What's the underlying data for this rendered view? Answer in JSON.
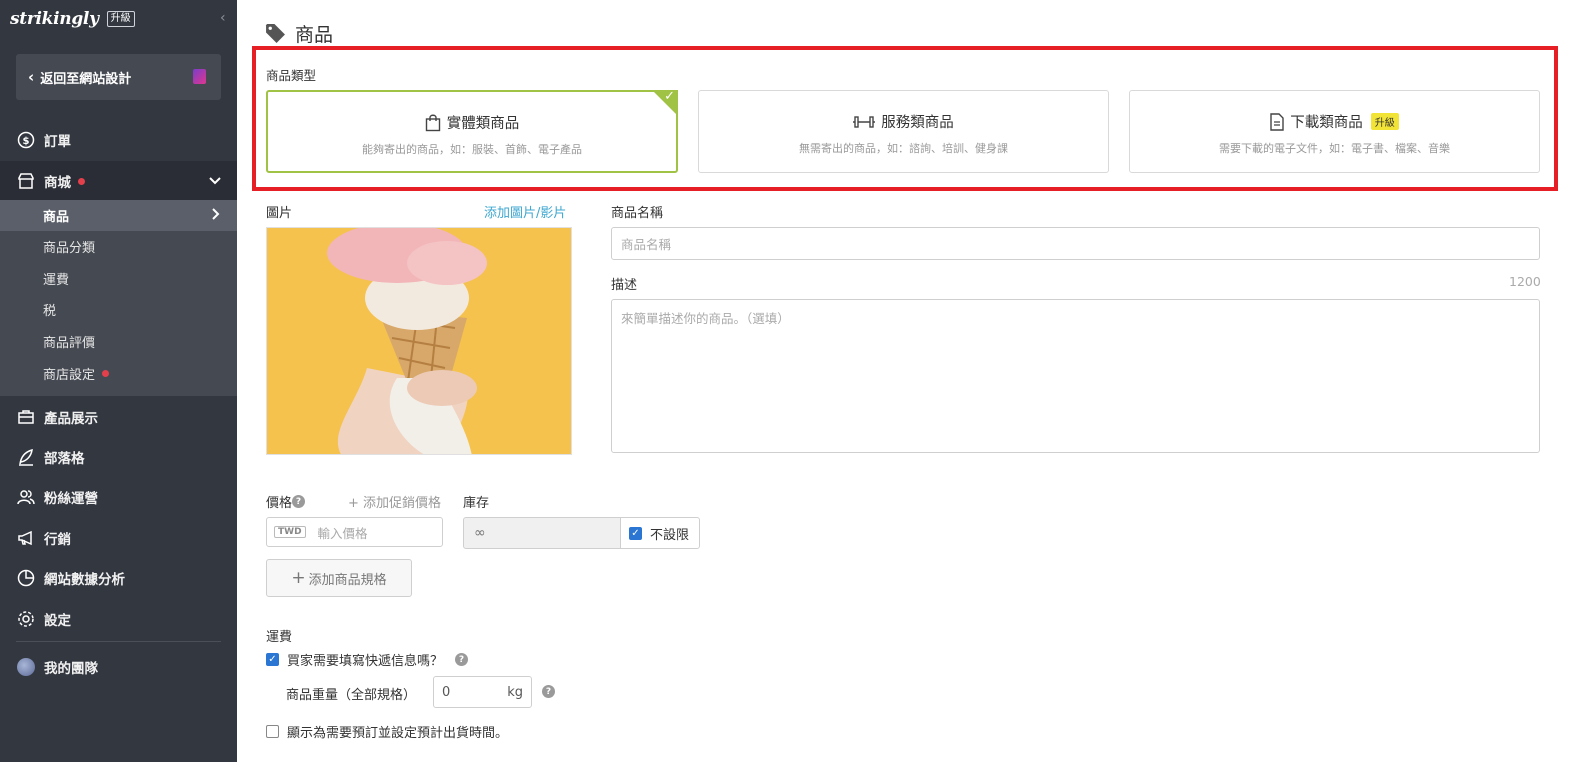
{
  "sidebar": {
    "logo": "strikingly",
    "upgrade": "升級",
    "back": "返回至網站設計",
    "nav": [
      {
        "label": "訂單"
      },
      {
        "label": "商城"
      },
      {
        "label": "產品展示"
      },
      {
        "label": "部落格"
      },
      {
        "label": "粉絲運營"
      },
      {
        "label": "行銷"
      },
      {
        "label": "網站數據分析"
      },
      {
        "label": "設定"
      },
      {
        "label": "我的團隊"
      }
    ],
    "sub": [
      {
        "label": "商品"
      },
      {
        "label": "商品分類"
      },
      {
        "label": "運費"
      },
      {
        "label": "税"
      },
      {
        "label": "商品評價"
      },
      {
        "label": "商店設定"
      }
    ]
  },
  "main": {
    "title": "商品",
    "type_label": "商品類型",
    "types": [
      {
        "title": "實體類商品",
        "desc": "能夠寄出的商品，如：服裝、首飾、電子產品",
        "selected": true
      },
      {
        "title": "服務類商品",
        "desc": "無需寄出的商品，如：諮詢、培訓、健身課",
        "selected": false
      },
      {
        "title": "下載類商品",
        "desc": "需要下載的電子文件，如：電子書、檔案、音樂",
        "badge": "升級",
        "selected": false
      }
    ],
    "image_label": "圖片",
    "add_media": "添加圖片/影片",
    "name_label": "商品名稱",
    "name_placeholder": "商品名稱",
    "desc_label": "描述",
    "desc_counter": "1200",
    "desc_placeholder": "來簡單描述你的商品。（選填）",
    "price_label": "價格",
    "add_promo": "+ 添加促銷價格",
    "currency": "TWD",
    "price_placeholder": "輸入價格",
    "stock_label": "庫存",
    "stock_value": "∞",
    "unlimited": "不設限",
    "add_variant": "添加商品規格",
    "shipping_label": "運費",
    "shipping_check": "買家需要填寫快遞信息嗎？",
    "weight_label": "商品重量（全部規格）",
    "weight_value": "0",
    "weight_unit": "kg",
    "preorder": "顯示為需要預訂並設定預計出貨時間。"
  },
  "colors": {
    "sidebar_bg": "#333740",
    "accent_green": "#a0c245",
    "highlight_red": "#e61e26",
    "link_blue": "#3fa7d1"
  }
}
